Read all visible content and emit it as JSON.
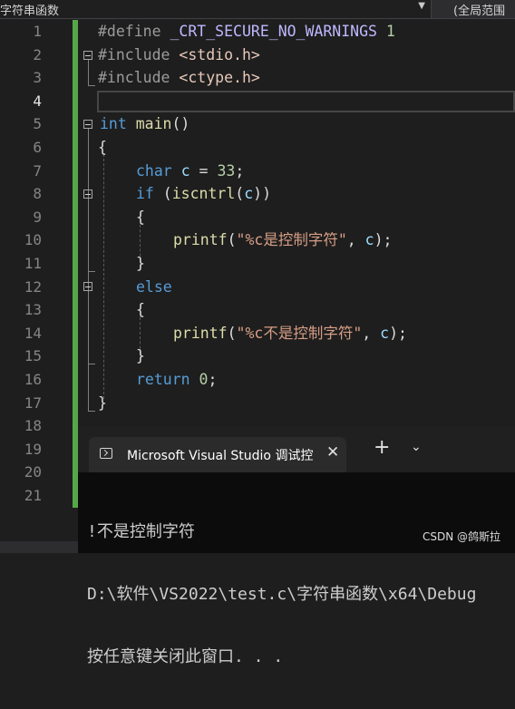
{
  "navbar": {
    "scope_label": "字符串函数",
    "global_label": "(全局范围"
  },
  "editor": {
    "line_numbers": [
      "1",
      "2",
      "3",
      "4",
      "5",
      "6",
      "7",
      "8",
      "9",
      "10",
      "11",
      "12",
      "13",
      "14",
      "15",
      "16",
      "17",
      "18",
      "19",
      "20",
      "21"
    ],
    "active_line": "4"
  },
  "code": {
    "l1": {
      "kw": "#define",
      "macro": "_CRT_SECURE_NO_WARNINGS",
      "num": "1"
    },
    "l2": {
      "kw": "#include",
      "file": "<stdio.h>"
    },
    "l3": {
      "kw": "#include",
      "file": "<ctype.h>"
    },
    "l5": {
      "type": "int",
      "fn": "main",
      "rest": "()"
    },
    "l6": {
      "brace": "{"
    },
    "l7": {
      "type": "char",
      "var": "c",
      "op": " = ",
      "num": "33",
      "end": ";"
    },
    "l8": {
      "kw": "if",
      "open": " (",
      "fn": "iscntrl",
      "p1": "(",
      "var": "c",
      "p2": "))"
    },
    "l9": {
      "brace": "{"
    },
    "l10": {
      "fn": "printf",
      "open": "(",
      "str": "\"%c是控制字符\"",
      "comma": ", ",
      "var": "c",
      "end": ");"
    },
    "l11": {
      "brace": "}"
    },
    "l12": {
      "kw": "else"
    },
    "l13": {
      "brace": "{"
    },
    "l14": {
      "fn": "printf",
      "open": "(",
      "str": "\"%c不是控制字符\"",
      "comma": ", ",
      "var": "c",
      "end": ");"
    },
    "l15": {
      "brace": "}"
    },
    "l16": {
      "kw": "return",
      "num": "0",
      "end": ";"
    },
    "l17": {
      "brace": "}"
    }
  },
  "console": {
    "tab_title": "Microsoft Visual Studio 调试控制台",
    "close_symbol": "✕",
    "new_tab_symbol": "+",
    "dropdown_symbol": "⌄",
    "output_lines": [
      "!不是控制字符",
      "D:\\软件\\VS2022\\test.c\\字符串函数\\x64\\Debug",
      "按任意键关闭此窗口. . ."
    ],
    "watermark": "CSDN @鸽斯拉"
  }
}
